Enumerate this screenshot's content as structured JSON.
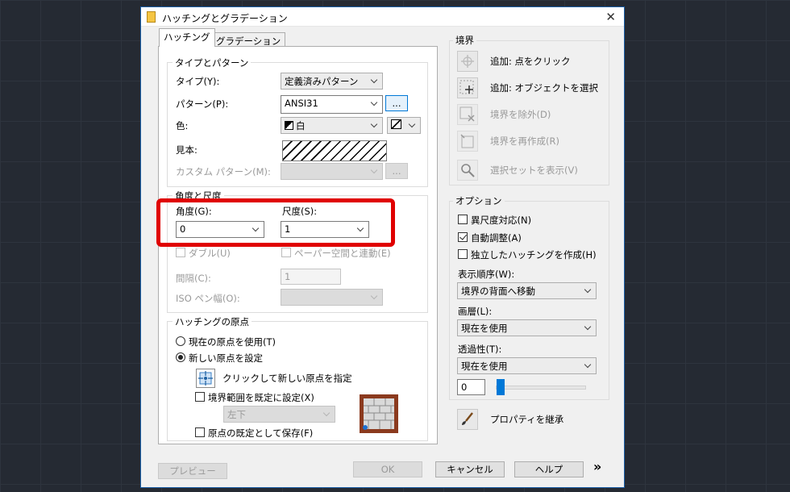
{
  "window": {
    "title": "ハッチングとグラデーション"
  },
  "tabs": [
    {
      "label": "ハッチング"
    },
    {
      "label": "グラデーション"
    }
  ],
  "type_pattern": {
    "group_label": "タイプとパターン",
    "type_label": "タイプ(Y):",
    "type_value": "定義済みパターン",
    "pattern_label": "パターン(P):",
    "pattern_value": "ANSI31",
    "pattern_browse": "...",
    "color_label": "色:",
    "color_value": "白",
    "sample_label": "見本:",
    "custom_label": "カスタム パターン(M):",
    "custom_browse": "..."
  },
  "angle_scale": {
    "group_label": "角度と尺度",
    "angle_label": "角度(G):",
    "angle_value": "0",
    "scale_label": "尺度(S):",
    "scale_value": "1",
    "double_label": "ダブル(U)",
    "paper_label": "ペーパー空間と連動(E)",
    "spacing_label": "間隔(C):",
    "spacing_value": "1",
    "iso_label": "ISO ペン幅(O):"
  },
  "origin": {
    "group_label": "ハッチングの原点",
    "use_current": "現在の原点を使用(T)",
    "specify_new": "新しい原点を設定",
    "click_new": "クリックして新しい原点を指定",
    "default_extents": "境界範囲を既定に設定(X)",
    "extents_value": "左下",
    "store_default": "原点の既定として保存(F)"
  },
  "boundaries": {
    "group_label": "境界",
    "add_pick": "追加: 点をクリック",
    "add_select": "追加: オブジェクトを選択",
    "remove": "境界を除外(D)",
    "recreate": "境界を再作成(R)",
    "view_selections": "選択セットを表示(V)"
  },
  "options": {
    "group_label": "オプション",
    "annotative": "異尺度対応(N)",
    "associative": "自動調整(A)",
    "separate": "独立したハッチングを作成(H)",
    "draw_order_label": "表示順序(W):",
    "draw_order_value": "境界の背面へ移動",
    "layer_label": "画層(L):",
    "layer_value": "現在を使用",
    "transparency_label": "透過性(T):",
    "transparency_value": "現在を使用",
    "transparency_number": "0",
    "transparency_fraction": 0
  },
  "inherit": {
    "label": "プロパティを継承"
  },
  "footer": {
    "preview": "プレビュー",
    "ok": "OK",
    "cancel": "キャンセル",
    "help": "ヘルプ",
    "more": "»"
  },
  "colors": {
    "highlight": "#e00000",
    "accent": "#0078d7"
  }
}
